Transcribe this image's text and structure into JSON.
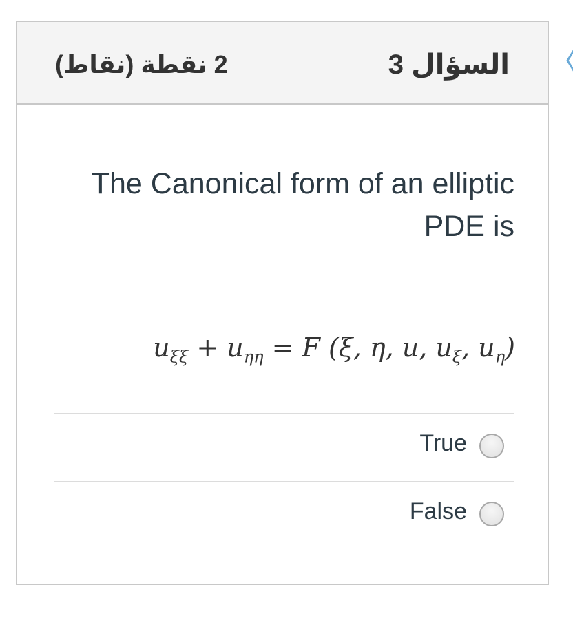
{
  "question": {
    "title": "السؤال 3",
    "points": "2 نقطة (نقاط)",
    "text": "The Canonical form of an elliptic PDE is",
    "formula": {
      "lhs_1": "u",
      "lhs_1_sub": "ξξ",
      "plus": "+",
      "lhs_2": "u",
      "lhs_2_sub": "ηη",
      "equals": "=",
      "rhs": "F (ξ, η, u, u",
      "rhs_sub_1": "ξ",
      "rhs_mid": ", u",
      "rhs_sub_2": "η",
      "rhs_end": ")"
    }
  },
  "answers": [
    {
      "label": "True",
      "selected": false
    },
    {
      "label": "False",
      "selected": false
    }
  ],
  "icons": {
    "nav": "chevron-left-icon",
    "radio": "radio-button-icon"
  },
  "colors": {
    "header_bg": "#f4f4f4",
    "border": "#c8c8c8",
    "text": "#2d3b45",
    "nav_accent": "#6aaad8"
  }
}
